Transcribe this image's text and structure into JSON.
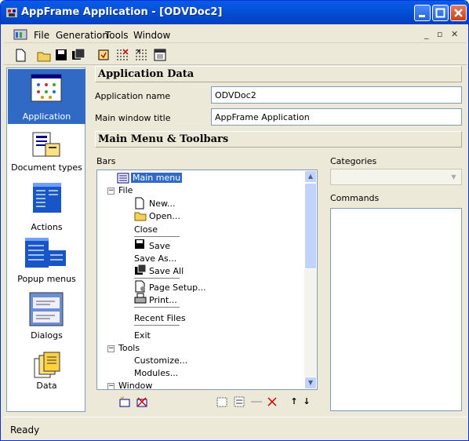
{
  "window": {
    "title": "AppFrame Application - [ODVDoc2]"
  },
  "menubar": {
    "items": [
      "File",
      "Generation",
      "Tools",
      "Window"
    ]
  },
  "sidebar": {
    "items": [
      {
        "label": "Application",
        "selected": true
      },
      {
        "label": "Document types"
      },
      {
        "label": "Actions"
      },
      {
        "label": "Popup menus"
      },
      {
        "label": "Dialogs"
      },
      {
        "label": "Data"
      }
    ]
  },
  "app_data": {
    "header": "Application Data",
    "name_label": "Application name",
    "name_value": "ODVDoc2",
    "title_label": "Main window title",
    "title_value": "AppFrame Application"
  },
  "menus": {
    "header": "Main Menu & Toolbars",
    "bars_label": "Bars",
    "categories_label": "Categories",
    "commands_label": "Commands",
    "tree": {
      "root": "Main menu",
      "file": "File",
      "file_items": [
        "New...",
        "Open...",
        "Close",
        "Save",
        "Save As...",
        "Save All",
        "Page Setup...",
        "Print...",
        "Recent Files",
        "Exit"
      ],
      "tools": "Tools",
      "tools_items": [
        "Customize...",
        "Modules..."
      ],
      "window": "Window"
    }
  },
  "status": {
    "text": "Ready"
  }
}
